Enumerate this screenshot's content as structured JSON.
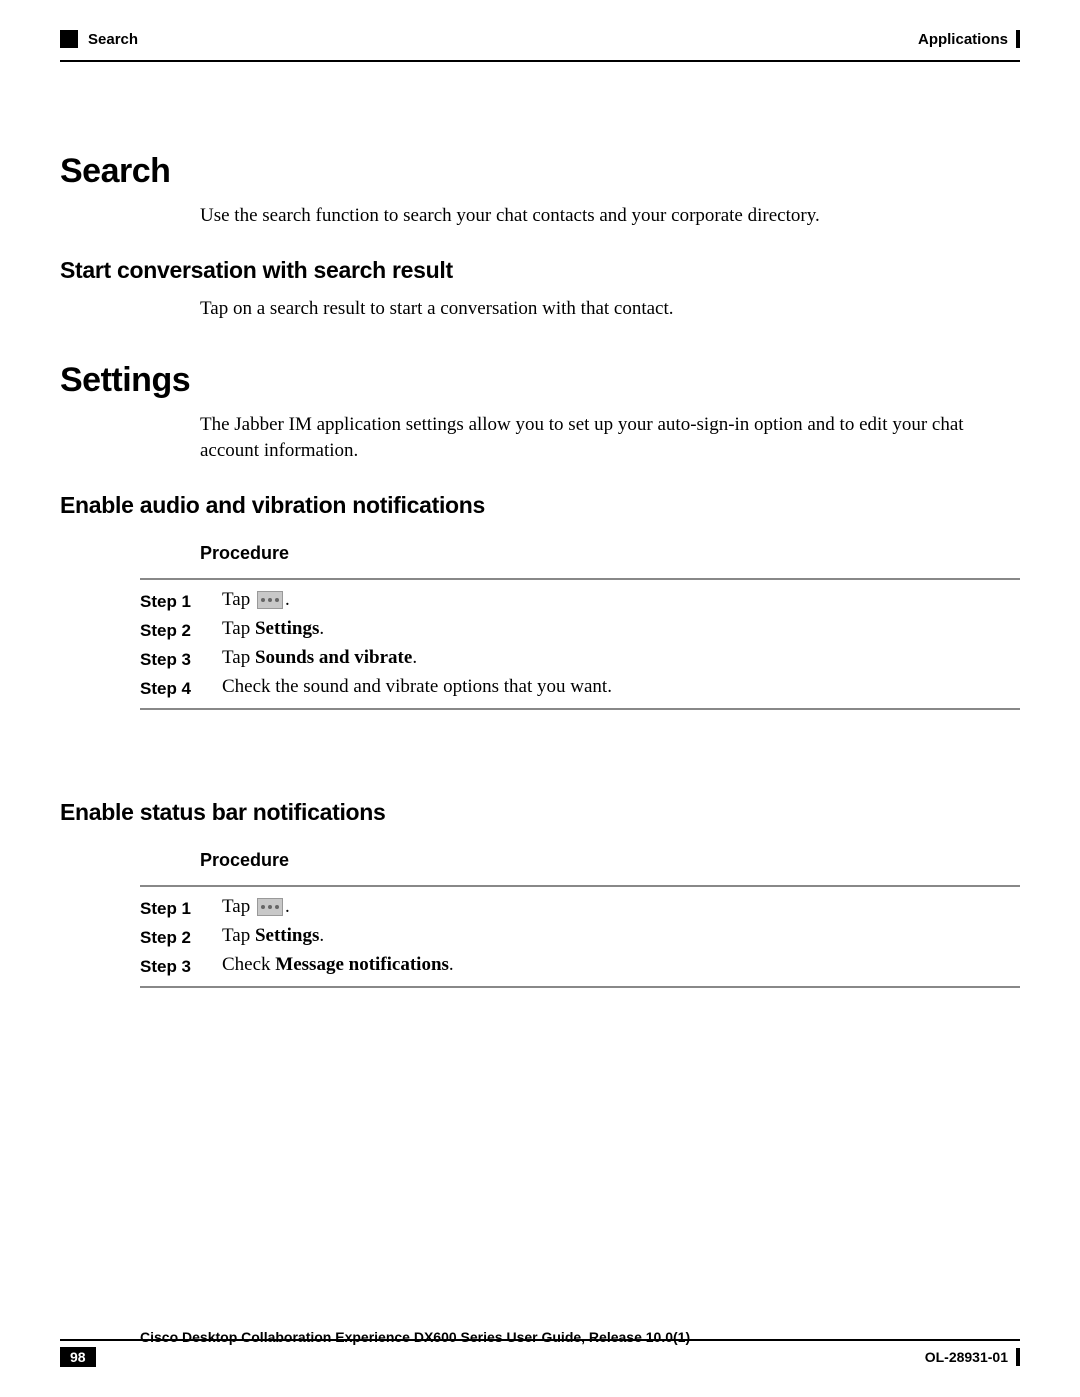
{
  "header": {
    "left": "Search",
    "right": "Applications"
  },
  "sections": {
    "search": {
      "title": "Search",
      "intro": "Use the search function to search your chat contacts and your corporate directory.",
      "sub1": {
        "title": "Start conversation with search result",
        "text": "Tap on a search result to start a conversation with that contact."
      }
    },
    "settings": {
      "title": "Settings",
      "intro": "The Jabber IM application settings allow you to set up your auto-sign-in option and to edit your chat account information.",
      "sub_audio": {
        "title": "Enable audio and vibration notifications",
        "procedure_label": "Procedure",
        "steps": [
          {
            "label": "Step 1",
            "prefix": "Tap ",
            "icon": true,
            "suffix": "."
          },
          {
            "label": "Step 2",
            "prefix": "Tap ",
            "bold": "Settings",
            "suffix": "."
          },
          {
            "label": "Step 3",
            "prefix": "Tap ",
            "bold": "Sounds and vibrate",
            "suffix": "."
          },
          {
            "label": "Step 4",
            "text": "Check the sound and vibrate options that you want."
          }
        ]
      },
      "sub_status": {
        "title": "Enable status bar notifications",
        "procedure_label": "Procedure",
        "steps": [
          {
            "label": "Step 1",
            "prefix": "Tap ",
            "icon": true,
            "suffix": "."
          },
          {
            "label": "Step 2",
            "prefix": "Tap ",
            "bold": "Settings",
            "suffix": "."
          },
          {
            "label": "Step 3",
            "prefix": "Check ",
            "bold": "Message notifications",
            "suffix": "."
          }
        ]
      }
    }
  },
  "footer": {
    "title": "Cisco Desktop Collaboration Experience DX600 Series User Guide, Release 10.0(1)",
    "page": "98",
    "doc_id": "OL-28931-01"
  }
}
